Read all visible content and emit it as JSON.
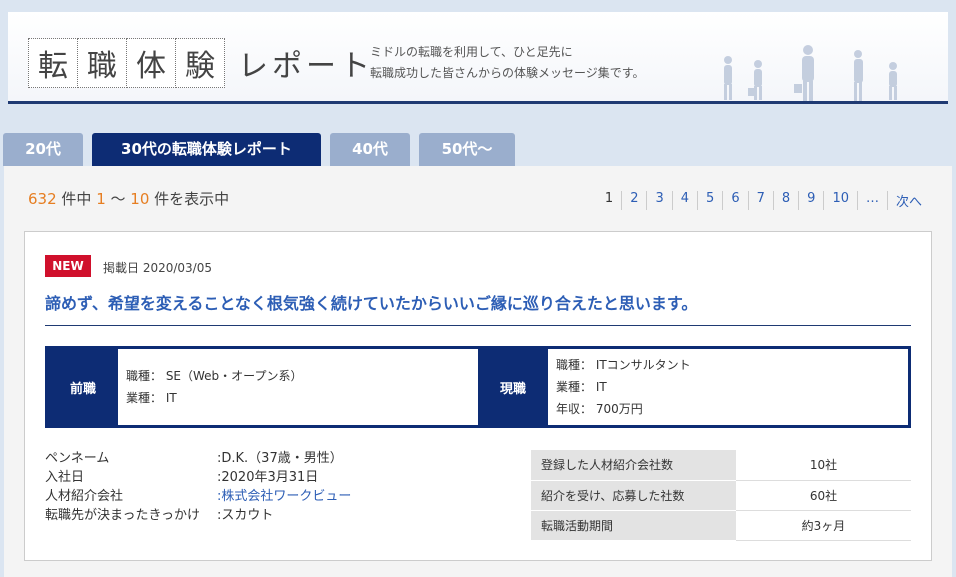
{
  "header": {
    "title_chars": [
      "転",
      "職",
      "体",
      "験"
    ],
    "subtitle": "レポート",
    "desc_line1": "ミドルの転職を利用して、ひと足先に",
    "desc_line2": "転職成功した皆さんからの体験メッセージ集です。"
  },
  "tabs": [
    {
      "label": "20代"
    },
    {
      "label": "30代の転職体験レポート"
    },
    {
      "label": "40代"
    },
    {
      "label": "50代〜"
    }
  ],
  "result": {
    "total": "632",
    "mid1": " 件中 ",
    "from": "1",
    "sep": " 〜 ",
    "to": "10",
    "suffix": " 件を表示中"
  },
  "pagination": [
    "1",
    "2",
    "3",
    "4",
    "5",
    "6",
    "7",
    "8",
    "9",
    "10",
    "…",
    "次へ"
  ],
  "card": {
    "badge": "NEW",
    "date": "掲載日 2020/03/05",
    "headline": "諦めず、希望を変えることなく根気強く続けていたからいいご縁に巡り合えたと思います。",
    "prev": {
      "label": "前職",
      "lines": [
        "職種：  SE（Web・オープン系）",
        "業種：  IT"
      ]
    },
    "curr": {
      "label": "現職",
      "lines": [
        "職種：  ITコンサルタント",
        "業種：  IT",
        "年収：  700万円"
      ]
    },
    "profile": [
      {
        "k": "ペンネーム",
        "v": ":D.K.（37歳・男性）"
      },
      {
        "k": "入社日",
        "v": ":2020年3月31日"
      },
      {
        "k": "人材紹介会社",
        "v": ":株式会社ワークビュー"
      },
      {
        "k": "転職先が決まったきっかけ",
        "v": ":スカウト"
      }
    ],
    "stats": [
      {
        "k": "登録した人材紹介会社数",
        "v": "10社"
      },
      {
        "k": "紹介を受け、応募した社数",
        "v": "60社"
      },
      {
        "k": "転職活動期間",
        "v": "約3ヶ月"
      }
    ]
  }
}
